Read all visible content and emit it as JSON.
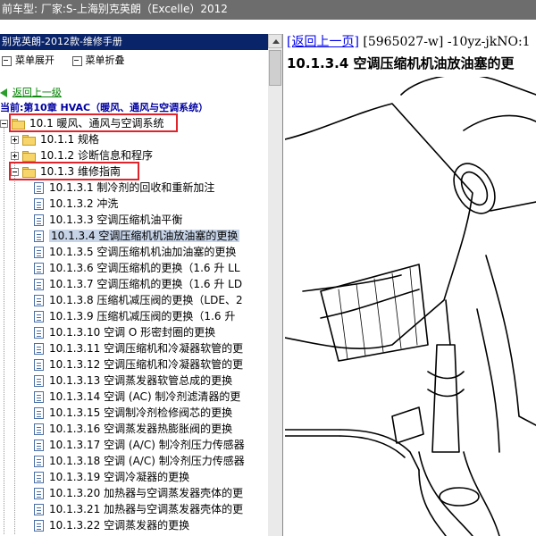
{
  "topbar": {
    "text": "前车型:  厂家:S-上海别克英朗（Excelle）2012"
  },
  "left": {
    "title": "别克英朗-2012款-维修手册",
    "toolbar": {
      "expand_label": "菜单展开",
      "collapse_label": "菜单折叠"
    },
    "back_label": "返回上一级",
    "current_label": "当前:第10章 HVAC（暖风、通风与空调系统）",
    "tree": {
      "node_10_1": "10.1 暖风、通风与空调系统",
      "node_10_1_1": "10.1.1 规格",
      "node_10_1_2": "10.1.2 诊断信息和程序",
      "node_10_1_3": "10.1.3 维修指南",
      "docs": [
        "10.1.3.1 制冷剂的回收和重新加注",
        "10.1.3.2 冲洗",
        "10.1.3.3 空调压缩机油平衡",
        "10.1.3.4 空调压缩机机油放油塞的更换",
        "10.1.3.5 空调压缩机机油加油塞的更换",
        "10.1.3.6 空调压缩机的更换（1.6 升 LL",
        "10.1.3.7 空调压缩机的更换（1.6 升 LD",
        "10.1.3.8 压缩机减压阀的更换（LDE、2",
        "10.1.3.9 压缩机减压阀的更换（1.6 升",
        "10.1.3.10 空调 O 形密封圈的更换",
        "10.1.3.11 空调压缩机和冷凝器软管的更",
        "10.1.3.12 空调压缩机和冷凝器软管的更",
        "10.1.3.13 空调蒸发器软管总成的更换",
        "10.1.3.14 空调 (AC) 制冷剂滤清器的更",
        "10.1.3.15 空调制冷剂检修阀芯的更换",
        "10.1.3.16 空调蒸发器热膨胀阀的更换",
        "10.1.3.17 空调 (A/C) 制冷剂压力传感器",
        "10.1.3.18 空调 (A/C) 制冷剂压力传感器",
        "10.1.3.19 空调冷凝器的更换",
        "10.1.3.20 加热器与空调蒸发器壳体的更",
        "10.1.3.21 加热器与空调蒸发器壳体的更",
        "10.1.3.22 空调蒸发器的更换"
      ]
    }
  },
  "right": {
    "back_link": "[返回上一页]",
    "doc_id": "[5965027-w] -10yz-jkNO:1",
    "title": "10.1.3.4 空调压缩机机油放油塞的更"
  },
  "colors": {
    "highlight_box": "#e0242b",
    "link": "#0000ee",
    "back_link": "#008000",
    "current": "#0000a0",
    "topbar": "#6d6d6d",
    "titlebar": "#0a246a"
  }
}
